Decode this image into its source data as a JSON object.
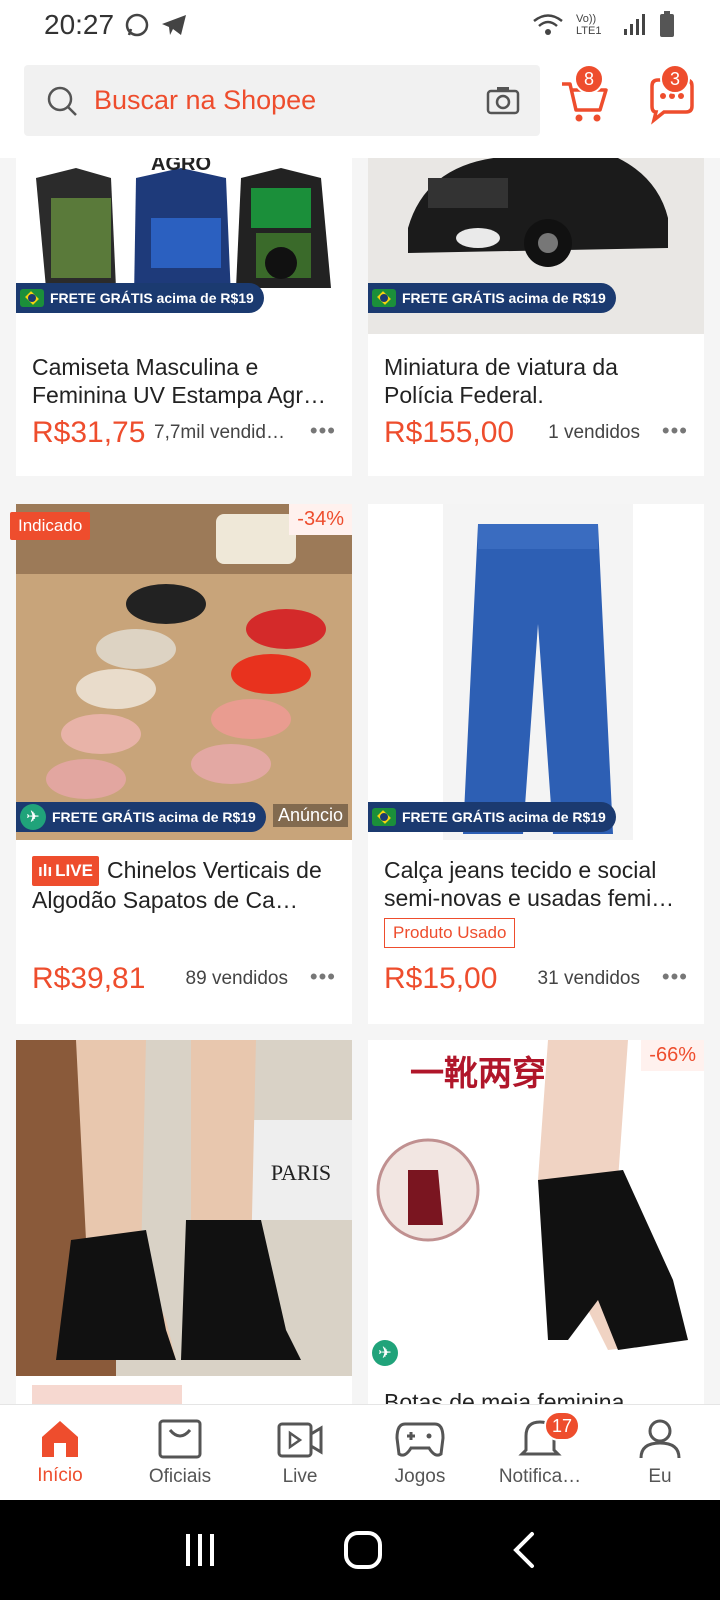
{
  "status": {
    "time": "20:27",
    "lte": "Vo)) LTE1"
  },
  "search": {
    "placeholder": "Buscar na Shopee"
  },
  "cart": {
    "count": "8"
  },
  "chat": {
    "count": "3"
  },
  "colors": {
    "accent": "#ee4d2d",
    "frete_bg": "#1b3a70"
  },
  "products": [
    {
      "title": "Camiseta Masculina e Feminina UV Estampa Agr…",
      "price": "R$31,75",
      "sold": "7,7mil vendid…",
      "frete": "FRETE GRÁTIS acima de R$19",
      "image_text": "AGRO"
    },
    {
      "title": "Miniatura de viatura da Polícia Federal.",
      "price": "R$155,00",
      "sold": "1 vendidos",
      "frete": "FRETE GRÁTIS acima de R$19"
    },
    {
      "title": "Chinelos Verticais de Algodão Sapatos de Ca…",
      "price": "R$39,81",
      "sold": "89 vendidos",
      "frete": "FRETE GRÁTIS acima de R$19",
      "discount": "-34%",
      "tag": "Indicado",
      "live": "LIVE",
      "ad": "Anúncio"
    },
    {
      "title": "Calça jeans tecido e social semi-novas e usadas femi…",
      "price": "R$15,00",
      "sold": "31 vendidos",
      "frete": "FRETE GRÁTIS acima de R$19",
      "condition": "Produto Usado"
    },
    {
      "title": "",
      "image_text": "PARIS"
    },
    {
      "title": "Botas de meia feminina",
      "discount": "-66%",
      "image_text": "一靴两穿"
    }
  ],
  "nav": [
    {
      "label": "Início",
      "icon": "home-icon"
    },
    {
      "label": "Oficiais",
      "icon": "bag-icon"
    },
    {
      "label": "Live",
      "icon": "live-video-icon"
    },
    {
      "label": "Jogos",
      "icon": "gamepad-icon"
    },
    {
      "label": "Notifica…",
      "icon": "bell-icon",
      "badge": "17"
    },
    {
      "label": "Eu",
      "icon": "user-icon"
    }
  ],
  "dots": "•••"
}
